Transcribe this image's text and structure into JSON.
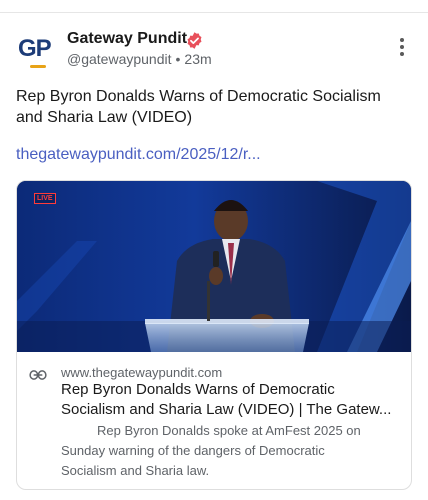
{
  "post": {
    "author_name": "Gateway Pundit",
    "avatar_text": "GP",
    "handle": "@gatewaypundit",
    "separator": "•",
    "time_ago": "23m",
    "text": "Rep Byron Donalds Warns of Democratic Socialism and Sharia Law (VIDEO)",
    "link_text": "thegatewaypundit.com/2025/12/r...",
    "verified_icon": "verified-badge-icon",
    "more_icon": "more-vertical-icon"
  },
  "card": {
    "live_badge": "LIVE",
    "domain": "www.thegatewaypundit.com",
    "title": "Rep Byron Donalds Warns of Democratic Socialism and Sharia Law (VIDEO) | The Gatew...",
    "description": "Rep Byron Donalds spoke at AmFest 2025 on Sunday warning of the dangers of Democratic Socialism and Sharia law.",
    "link_icon": "link-icon"
  },
  "colors": {
    "link": "#4a5fc1",
    "verified": "#e8505b",
    "avatar_text": "#1d3c78",
    "avatar_accent": "#e8a317",
    "muted_text": "#5f6368"
  }
}
